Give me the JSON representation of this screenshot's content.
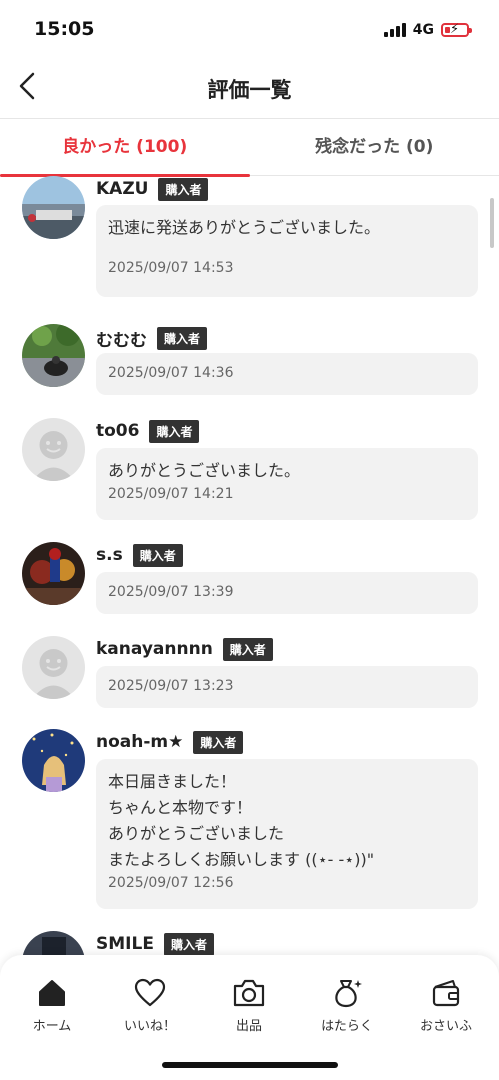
{
  "status": {
    "time": "15:05",
    "network": "4G"
  },
  "header": {
    "title": "評価一覧"
  },
  "tabs": [
    {
      "label": "良かった (100)",
      "active": true
    },
    {
      "label": "残念だった (0)",
      "active": false
    }
  ],
  "badge_label": "購入者",
  "reviews": [
    {
      "username": "KAZU",
      "comment": "迅速に発送ありがとうございました。",
      "timestamp": "2025/09/07 14:53",
      "avatar": "photo-city"
    },
    {
      "username": "むむむ",
      "comment": "",
      "timestamp": "2025/09/07 14:36",
      "avatar": "photo-motorcycle"
    },
    {
      "username": "to06",
      "comment": "ありがとうございました。",
      "timestamp": "2025/09/07 14:21",
      "avatar": "default-avatar"
    },
    {
      "username": "s.s",
      "comment": "",
      "timestamp": "2025/09/07 13:39",
      "avatar": "photo-figures"
    },
    {
      "username": "kanayannnn",
      "comment": "",
      "timestamp": "2025/09/07 13:23",
      "avatar": "default-avatar"
    },
    {
      "username": "noah-m★",
      "comment": "本日届きました！\nちゃんと本物です！\nありがとうございました\nまたよろしくお願いします ((⋆- -⋆))\"",
      "timestamp": "2025/09/07 12:56",
      "avatar": "photo-illustration"
    },
    {
      "username": "SMILE",
      "comment": "",
      "timestamp": "",
      "avatar": "photo-dark"
    }
  ],
  "nav": [
    {
      "label": "ホーム",
      "icon": "home-icon",
      "active": true
    },
    {
      "label": "いいね！",
      "icon": "heart-icon",
      "active": false
    },
    {
      "label": "出品",
      "icon": "camera-icon",
      "active": false
    },
    {
      "label": "はたらく",
      "icon": "money-bag-icon",
      "active": false
    },
    {
      "label": "おさいふ",
      "icon": "wallet-icon",
      "active": false
    }
  ],
  "colors": {
    "accent": "#e8343c",
    "badge": "#333333",
    "bubble": "#f2f2f2"
  }
}
